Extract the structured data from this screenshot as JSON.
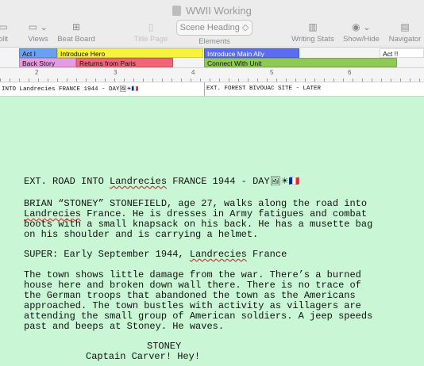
{
  "window": {
    "title": "WWII Working"
  },
  "toolbar": {
    "items": [
      {
        "label": "olit",
        "icon": "split-icon"
      },
      {
        "label": "Views",
        "icon": "views-icon"
      },
      {
        "label": "Beat Board",
        "icon": "beat-board-icon"
      },
      {
        "label": "Title Page",
        "icon": "title-page-icon"
      },
      {
        "label": "Elements",
        "icon": "elements-icon"
      },
      {
        "label": "Writing Stats",
        "icon": "writing-stats-icon"
      },
      {
        "label": "Show/Hide",
        "icon": "eye-icon"
      },
      {
        "label": "Navigator",
        "icon": "navigator-icon"
      }
    ],
    "element_dropdown": "Scene Heading ◇"
  },
  "timeline": {
    "row1": [
      {
        "label": "Act I",
        "color": "#6aa0f0"
      },
      {
        "label": "Introduce Hero",
        "color": "#f6f33a"
      },
      {
        "label": "Introduce Main Ally",
        "color": "#5a6cf0"
      },
      {
        "label": "Act !!",
        "color": "#ffffff"
      }
    ],
    "row2": [
      {
        "label": "Back Story",
        "color": "#e49be0"
      },
      {
        "label": "Returns from Paris",
        "color": "#ee6677"
      },
      {
        "label": "Connect With Unit",
        "color": "#8fc957"
      }
    ]
  },
  "ruler": {
    "numbers": [
      "2",
      "3",
      "4",
      "5",
      "6"
    ]
  },
  "scene_strip": {
    "scene1": "INTO Landrecies FRANCE 1944 - DAY",
    "scene1_emoji": "🖼☀🇫🇷",
    "scene2": "EXT. FOREST BIVOUAC SITE - LATER"
  },
  "script": {
    "heading_pre": "EXT. ROAD INTO ",
    "heading_place": "Landrecies",
    "heading_post": " FRANCE 1944 - DAY",
    "heading_emoji": "🖼☀🇫🇷",
    "action1_line1": "BRIAN “STONEY” STONEFIELD, age 27, walks along the road into",
    "action1_line2_place": "Landrecies",
    "action1_line2_rest": " France. He is dresses in Army fatigues and combat",
    "action1_line3": "boots with a small knapsack on his back. He has a musette bag",
    "action1_line4": "on his shoulder and is carrying a helmet.",
    "super_pre": "SUPER: Early September 1944, ",
    "super_place": "Landrecies",
    "super_post": " France",
    "action2_line1": "The town shows little damage from the war. There’s a burned",
    "action2_line2": "house here and broken down wall there. There is no trace of",
    "action2_line3": "the German troops that abandoned the town as the Americans",
    "action2_line4": "approached. The town bustles with activity as villagers are",
    "action2_line5": "attending the small group of American soldiers. A jeep speeds",
    "action2_line6": "past and beeps at Stoney. He waves.",
    "character": "STONEY",
    "dialogue": "Captain Carver! Hey!"
  }
}
